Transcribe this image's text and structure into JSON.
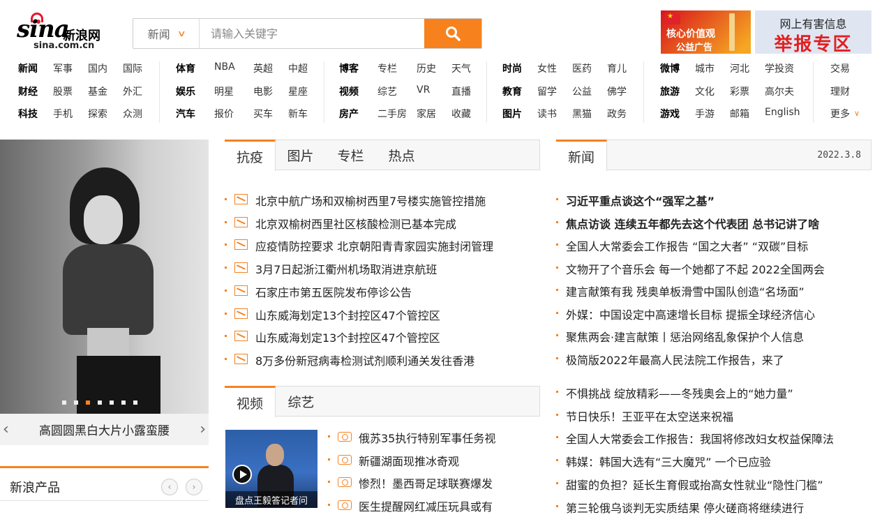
{
  "header": {
    "logo_mark": "sina",
    "logo_cn": "新浪网",
    "logo_domain": "sina.com.cn",
    "search_scope": "新闻",
    "search_placeholder": "请输入关键字",
    "ad1_line1": "核心价值观",
    "ad1_line2": "公益广告",
    "ad2_line1": "网上有害信息",
    "ad2_line2": "举报专区"
  },
  "nav": {
    "groups": [
      [
        [
          "新闻",
          "军事",
          "国内",
          "国际"
        ],
        [
          "财经",
          "股票",
          "基金",
          "外汇"
        ],
        [
          "科技",
          "手机",
          "探索",
          "众测"
        ]
      ],
      [
        [
          "体育",
          "NBA",
          "英超",
          "中超"
        ],
        [
          "娱乐",
          "明星",
          "电影",
          "星座"
        ],
        [
          "汽车",
          "报价",
          "买车",
          "新车"
        ]
      ],
      [
        [
          "博客",
          "专栏",
          "历史",
          "天气"
        ],
        [
          "视频",
          "综艺",
          "VR",
          "直播"
        ],
        [
          "房产",
          "二手房",
          "家居",
          "收藏"
        ]
      ],
      [
        [
          "时尚",
          "女性",
          "医药",
          "育儿"
        ],
        [
          "教育",
          "留学",
          "公益",
          "佛学"
        ],
        [
          "图片",
          "读书",
          "黑猫",
          "政务"
        ]
      ],
      [
        [
          "微博",
          "城市",
          "河北",
          "学投资"
        ],
        [
          "旅游",
          "文化",
          "彩票",
          "高尔夫"
        ],
        [
          "游戏",
          "手游",
          "邮箱",
          "English"
        ]
      ]
    ],
    "extra": [
      "交易",
      "理财",
      "更多"
    ]
  },
  "slideshow": {
    "caption": "高圆圆黑白大片小露蛮腰",
    "dots": 7,
    "active_dot": 3
  },
  "products": {
    "title": "新浪产品"
  },
  "tabs1": [
    "抗疫",
    "图片",
    "专栏",
    "热点"
  ],
  "list1": [
    "北京中航广场和双榆树西里7号楼实施管控措施",
    "北京双榆树西里社区核酸检测已基本完成",
    "应疫情防控要求 北京朝阳青青家园实施封闭管理",
    "3月7日起浙江衢州机场取消进京航班",
    "石家庄市第五医院发布停诊公告",
    "山东威海划定13个封控区47个管控区",
    "山东威海划定13个封控区47个管控区",
    "8万多份新冠病毒检测试剂顺利通关发往香港"
  ],
  "tabs2": [
    "视频",
    "综艺"
  ],
  "video": {
    "caption": "盘点王毅答记者问",
    "items": [
      "俄苏35执行特别军事任务视",
      "新疆湖面现推冰奇观",
      "惨烈！墨西哥足球联赛爆发",
      "医生提醒网红减压玩具或有"
    ]
  },
  "news": {
    "tab": "新闻",
    "date": "2022.3.8",
    "headlines": [
      "习近平重点谈这个“强军之基”",
      "焦点访谈 连续五年都先去这个代表团 总书记讲了啥"
    ],
    "items": [
      "全国人大常委会工作报告 “国之大者” “双碳”目标",
      "文物开了个音乐会 每一个她都了不起 2022全国两会",
      "建言献策有我 残奥单板滑雪中国队创造“名场面”",
      "外媒：中国设定中高速增长目标 提振全球经济信心",
      "聚焦两会·建言献策丨惩治网络乱象保护个人信息",
      "极简版2022年最高人民法院工作报告，来了"
    ],
    "items2": [
      "不惧挑战 绽放精彩——冬残奥会上的“她力量”",
      "节日快乐！王亚平在太空送来祝福",
      "全国人大常委会工作报告：我国将修改妇女权益保障法",
      "韩媒：韩国大选有“三大魔咒” 一个已应验",
      "甜蜜的负担？延长生育假或抬高女性就业“隐性门槛”",
      "第三轮俄乌谈判无实质结果 停火磋商将继续进行"
    ]
  },
  "colors": {
    "accent": "#f58220"
  }
}
